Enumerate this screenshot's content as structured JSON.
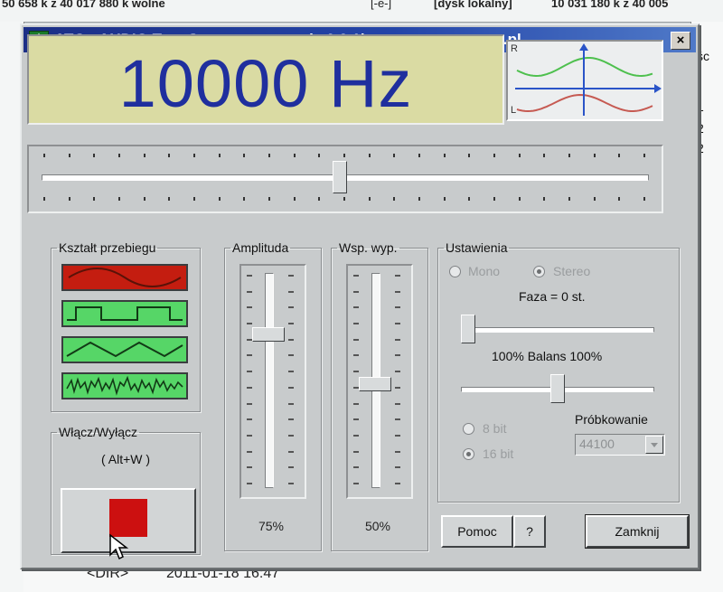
{
  "background": {
    "top_bar": {
      "free_space_left": "50 658 k z 40 017 880 k wolne",
      "drive_selector": "[-e-]",
      "drive_label": "[dysk lokalny]",
      "free_space_right": "10 031 180 k z 40 005"
    },
    "right_column": [
      "śc",
      "1",
      "2",
      "2"
    ],
    "bottom_row": {
      "dir_label": "<DIR>",
      "timestamp": "2011-01-18 16:47"
    }
  },
  "window": {
    "title": "ATG - AUDIO Test Generator - wersja 0.9.1b - www.tgs.sys.net.pl",
    "close_label": "×"
  },
  "display": {
    "frequency": "10000 Hz"
  },
  "scope": {
    "channel_right": "R",
    "channel_left": "L",
    "color_right": "#4ec04e",
    "color_left": "#c65a52",
    "axis_color": "#2a54c8"
  },
  "frequency_slider": {
    "position_fraction": 0.5
  },
  "waveform_group": {
    "label": "Kształt przebiegu",
    "options": [
      {
        "name": "sine",
        "selected": true,
        "color": "#c41d10"
      },
      {
        "name": "square",
        "selected": false,
        "color": "#56d667"
      },
      {
        "name": "triangle",
        "selected": false,
        "color": "#56d667"
      },
      {
        "name": "noise",
        "selected": false,
        "color": "#56d667"
      }
    ]
  },
  "power_group": {
    "label": "Włącz/Wyłącz",
    "shortcut": "( Alt+W )",
    "indicator_color": "#cc1010"
  },
  "amplitude": {
    "label": "Amplituda",
    "value_text": "75%",
    "level_fraction": 0.75
  },
  "duty": {
    "label": "Wsp. wyp.",
    "value_text": "50%",
    "level_fraction": 0.5
  },
  "settings": {
    "label": "Ustawienia",
    "mono_label": "Mono",
    "stereo_label": "Stereo",
    "channel_mode": "stereo",
    "phase_label": "Faza = 0 st.",
    "phase_fraction": 0.0,
    "balance_label": "100% Balans 100%",
    "balance_fraction": 0.5,
    "bit8_label": "8 bit",
    "bit16_label": "16 bit",
    "bit_depth": "16 bit",
    "sampling_label": "Próbkowanie",
    "sampling_value": "44100"
  },
  "buttons": {
    "help": "Pomoc",
    "question": "?",
    "close": "Zamknij"
  }
}
